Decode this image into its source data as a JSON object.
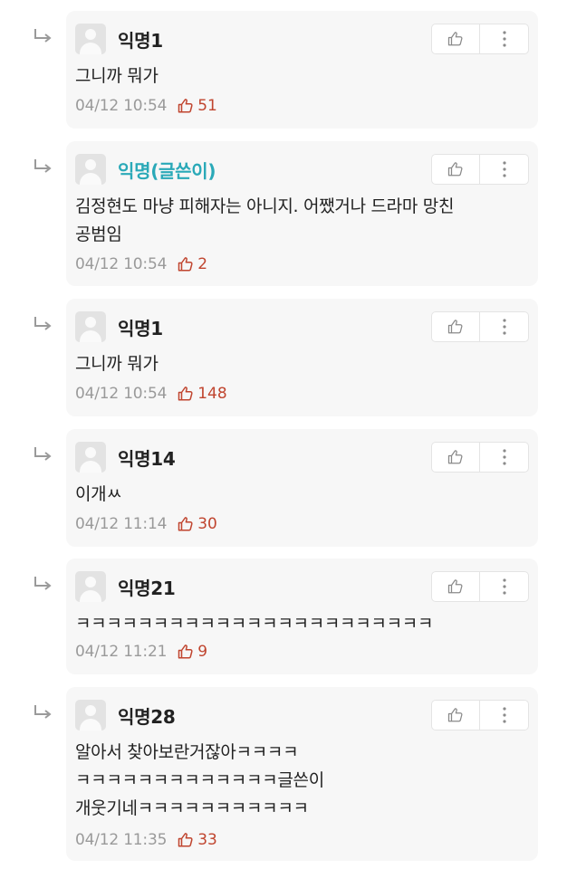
{
  "colors": {
    "card_bg": "#f7f7f7",
    "author_nick": "#2aa9b8",
    "like_count": "#c0452f",
    "time": "#9a9a9a"
  },
  "icons": {
    "reply": "reply-arrow-icon",
    "like_button": "thumbs-up-icon",
    "more_button": "more-vertical-icon",
    "like_count": "thumbs-up-icon",
    "avatar": "user-icon"
  },
  "comments": [
    {
      "nickname": "익명1",
      "is_author": false,
      "lines": [
        "그니까 뭐가"
      ],
      "time": "04/12 10:54",
      "likes": "51"
    },
    {
      "nickname": "익명(글쓴이)",
      "is_author": true,
      "lines": [
        "김정현도 마냥 피해자는 아니지. 어쨌거나 드라마 망친",
        "공범임"
      ],
      "time": "04/12 10:54",
      "likes": "2"
    },
    {
      "nickname": "익명1",
      "is_author": false,
      "lines": [
        "그니까 뭐가"
      ],
      "time": "04/12 10:54",
      "likes": "148"
    },
    {
      "nickname": "익명14",
      "is_author": false,
      "lines": [
        "이개ㅆ"
      ],
      "time": "04/12 11:14",
      "likes": "30"
    },
    {
      "nickname": "익명21",
      "is_author": false,
      "lines": [
        "ㅋㅋㅋㅋㅋㅋㅋㅋㅋㅋㅋㅋㅋㅋㅋㅋㅋㅋㅋㅋㅋㅋㅋ"
      ],
      "time": "04/12 11:21",
      "likes": "9"
    },
    {
      "nickname": "익명28",
      "is_author": false,
      "lines": [
        "알아서 찾아보란거잖아ㅋㅋㅋㅋ",
        "ㅋㅋㅋㅋㅋㅋㅋㅋㅋㅋㅋㅋㅋ글쓴이",
        "개웃기네ㅋㅋㅋㅋㅋㅋㅋㅋㅋㅋㅋ"
      ],
      "time": "04/12 11:35",
      "likes": "33"
    }
  ]
}
